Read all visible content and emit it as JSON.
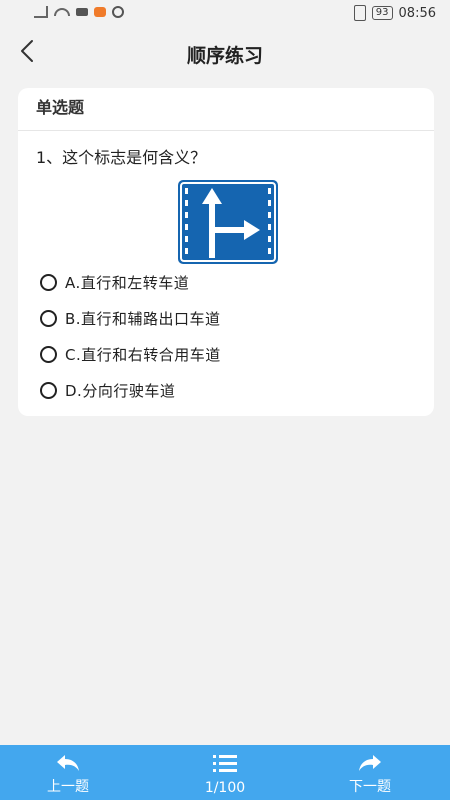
{
  "statusbar": {
    "battery": "93",
    "time": "08:56"
  },
  "header": {
    "title": "顺序练习"
  },
  "card": {
    "type_label": "单选题",
    "question": "1、这个标志是何含义？",
    "options": [
      {
        "text": "A.直行和左转车道"
      },
      {
        "text": "B.直行和辅路出口车道"
      },
      {
        "text": "C.直行和右转合用车道"
      },
      {
        "text": "D.分向行驶车道"
      }
    ]
  },
  "bottombar": {
    "prev_label": "上一题",
    "progress": "1/100",
    "next_label": "下一题"
  },
  "colors": {
    "accent": "#43a7ee",
    "sign_blue": "#1565b0"
  },
  "icons": [
    "back-arrow",
    "undo-arrow",
    "list",
    "redo-arrow"
  ]
}
